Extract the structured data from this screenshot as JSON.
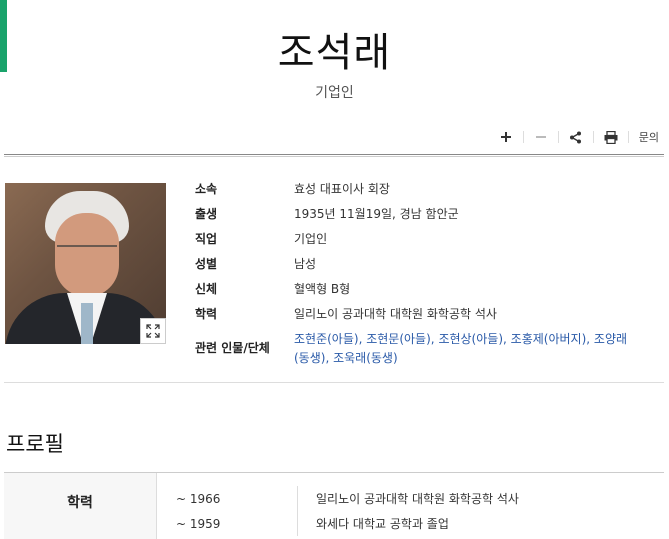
{
  "header": {
    "title": "조석래",
    "subtitle": "기업인"
  },
  "toolbar": {
    "zoom_in": "+",
    "zoom_out": "−",
    "share": "share",
    "print": "print",
    "inquiry": "문의"
  },
  "info": [
    {
      "label": "소속",
      "value": "효성 대표이사 회장"
    },
    {
      "label": "출생",
      "value": "1935년 11월19일, 경남 함안군"
    },
    {
      "label": "직업",
      "value": "기업인"
    },
    {
      "label": "성별",
      "value": "남성"
    },
    {
      "label": "신체",
      "value": "혈액형 B형"
    },
    {
      "label": "학력",
      "value": "일리노이 공과대학 대학원 화학공학 석사"
    }
  ],
  "related": {
    "label": "관련 인물/단체",
    "people": [
      "조현준(아들),",
      "조현문(아들),",
      "조현상(아들),",
      "조홍제(아버지),",
      "조양래",
      "(동생),",
      "조욱래(동생)"
    ]
  },
  "profile": {
    "title": "프로필",
    "label": "학력",
    "rows": [
      {
        "year": "~ 1966",
        "desc": "일리노이 공과대학 대학원 화학공학 석사"
      },
      {
        "year": "~ 1959",
        "desc": "와세다 대학교 공학과 졸업"
      }
    ]
  },
  "colors": {
    "accent": "#1aa36b",
    "link": "#2a5aa8"
  }
}
